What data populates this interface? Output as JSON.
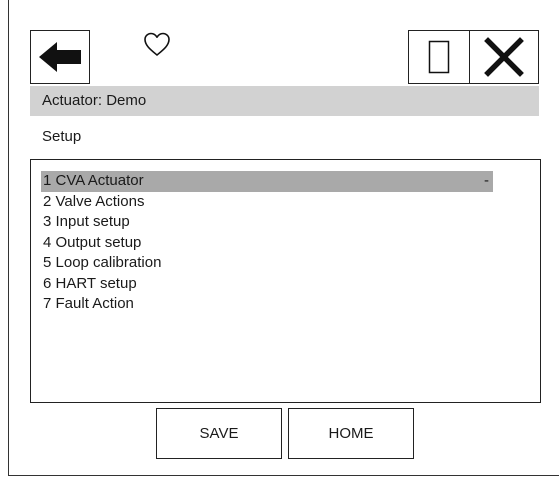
{
  "header": {
    "back_icon": "back-arrow-icon",
    "favorite_icon": "heart-outline-icon",
    "window_icon": "window-rectangle-icon",
    "close_icon": "close-x-icon"
  },
  "title_bar": {
    "text": "Actuator: Demo",
    "background": "#d2d2d2"
  },
  "section": {
    "label": "Setup"
  },
  "menu": {
    "items": [
      {
        "label": "1 CVA Actuator",
        "value": "-",
        "selected": true
      },
      {
        "label": "2 Valve Actions",
        "value": "",
        "selected": false
      },
      {
        "label": "3 Input setup",
        "value": "",
        "selected": false
      },
      {
        "label": "4 Output setup",
        "value": "",
        "selected": false
      },
      {
        "label": "5 Loop calibration",
        "value": "",
        "selected": false
      },
      {
        "label": "6 HART setup",
        "value": "",
        "selected": false
      },
      {
        "label": "7 Fault Action",
        "value": "",
        "selected": false
      }
    ],
    "selected_color": "#a9a9a9"
  },
  "footer": {
    "save_label": "SAVE",
    "home_label": "HOME"
  }
}
